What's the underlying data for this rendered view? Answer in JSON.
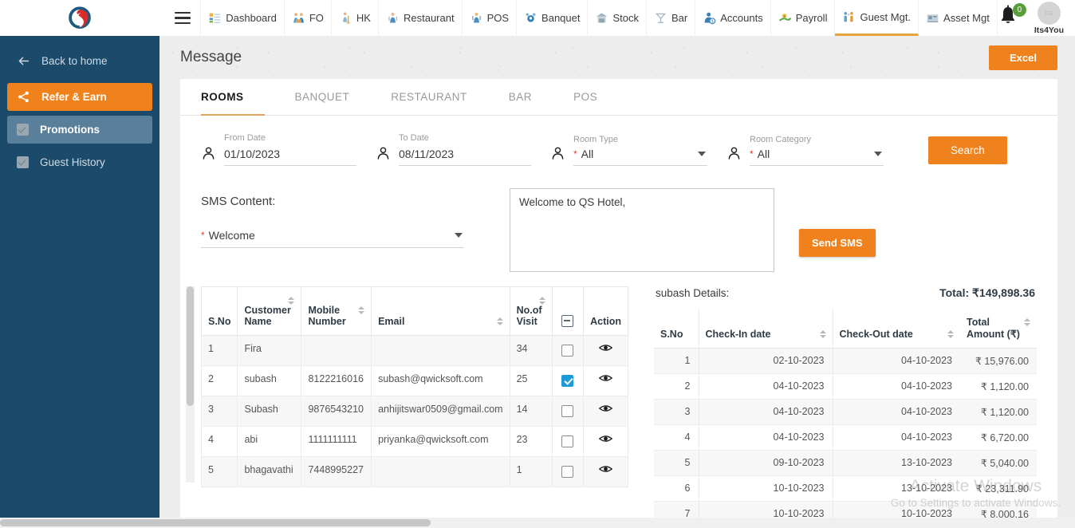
{
  "topnav": {
    "logo_name": "qs-logo",
    "menu_toggle": "menu-toggle",
    "items": [
      {
        "label": "Dashboard",
        "icon": "dashboard-icon",
        "active": false
      },
      {
        "label": "FO",
        "icon": "front-office-icon",
        "active": false
      },
      {
        "label": "HK",
        "icon": "housekeeping-icon",
        "active": false
      },
      {
        "label": "Restaurant",
        "icon": "restaurant-icon",
        "active": false
      },
      {
        "label": "POS",
        "icon": "pos-icon",
        "active": false
      },
      {
        "label": "Banquet",
        "icon": "banquet-icon",
        "active": false
      },
      {
        "label": "Stock",
        "icon": "stock-icon",
        "active": false
      },
      {
        "label": "Bar",
        "icon": "bar-icon",
        "active": false
      },
      {
        "label": "Accounts",
        "icon": "accounts-icon",
        "active": false
      },
      {
        "label": "Payroll",
        "icon": "payroll-icon",
        "active": false
      },
      {
        "label": "Guest Mgt.",
        "icon": "guest-management-icon",
        "active": true
      },
      {
        "label": "Asset Mgt",
        "icon": "asset-management-icon",
        "active": false
      }
    ],
    "notification_count": "0",
    "user_initials": "Its",
    "user_name": "Its4You"
  },
  "sidebar": {
    "back_label": "Back to home",
    "items": [
      {
        "label": "Refer & Earn",
        "icon": "share-icon",
        "state": "active"
      },
      {
        "label": "Promotions",
        "icon": "checkbox-icon",
        "state": "selected"
      },
      {
        "label": "Guest History",
        "icon": "checkbox-icon",
        "state": "normal"
      }
    ]
  },
  "header": {
    "title": "Message",
    "excel_label": "Excel"
  },
  "tabs": [
    {
      "label": "ROOMS",
      "active": true
    },
    {
      "label": "BANQUET",
      "active": false
    },
    {
      "label": "RESTAURANT",
      "active": false
    },
    {
      "label": "BAR",
      "active": false
    },
    {
      "label": "POS",
      "active": false
    }
  ],
  "filters": {
    "from_date": {
      "label": "From Date",
      "value": "01/10/2023"
    },
    "to_date": {
      "label": "To Date",
      "value": "08/11/2023"
    },
    "room_type": {
      "label": "Room Type",
      "value": "All",
      "required": "*"
    },
    "room_category": {
      "label": "Room Category",
      "value": "All",
      "required": "*"
    },
    "search_label": "Search"
  },
  "sms": {
    "title": "SMS Content:",
    "template_value": "Welcome",
    "template_required": "*",
    "message_value": "Welcome to QS Hotel,",
    "send_label": "Send SMS"
  },
  "customer_table": {
    "columns": [
      "S.No",
      "Customer Name",
      "Mobile Number",
      "Email",
      "No.of Visit",
      "",
      "Action"
    ],
    "select_all_icon": "indeterminate-checkbox-icon",
    "rows": [
      {
        "sno": "1",
        "name": "Fira",
        "mobile": "",
        "email": "",
        "visits": "34",
        "checked": false
      },
      {
        "sno": "2",
        "name": "subash",
        "mobile": "8122216016",
        "email": "subash@qwicksoft.com",
        "visits": "25",
        "checked": true
      },
      {
        "sno": "3",
        "name": "Subash",
        "mobile": "9876543210",
        "email": "anhijitswar0509@gmail.com",
        "visits": "14",
        "checked": false
      },
      {
        "sno": "4",
        "name": "abi",
        "mobile": "1111111111",
        "email": "priyanka@qwicksoft.com",
        "visits": "23",
        "checked": false
      },
      {
        "sno": "5",
        "name": "bhagavathi",
        "mobile": "7448995227",
        "email": "",
        "visits": "1",
        "checked": false
      }
    ]
  },
  "details_panel": {
    "title": "subash Details:",
    "total_label": "Total: ₹149,898.36",
    "columns": [
      "S.No",
      "Check-In date",
      "Check-Out date",
      "Total Amount (₹)"
    ],
    "rows": [
      {
        "sno": "1",
        "checkin": "02-10-2023",
        "checkout": "04-10-2023",
        "amount": "₹ 15,976.00"
      },
      {
        "sno": "2",
        "checkin": "04-10-2023",
        "checkout": "04-10-2023",
        "amount": "₹ 1,120.00"
      },
      {
        "sno": "3",
        "checkin": "04-10-2023",
        "checkout": "04-10-2023",
        "amount": "₹ 1,120.00"
      },
      {
        "sno": "4",
        "checkin": "04-10-2023",
        "checkout": "04-10-2023",
        "amount": "₹ 6,720.00"
      },
      {
        "sno": "5",
        "checkin": "09-10-2023",
        "checkout": "13-10-2023",
        "amount": "₹ 5,040.00"
      },
      {
        "sno": "6",
        "checkin": "10-10-2023",
        "checkout": "13-10-2023",
        "amount": "₹ 23,311.90"
      },
      {
        "sno": "7",
        "checkin": "10-10-2023",
        "checkout": "10-10-2023",
        "amount": "₹ 8,000.16"
      }
    ]
  },
  "watermark": {
    "line1": "Activate Windows",
    "line2": "Go to Settings to activate Windows."
  },
  "colors": {
    "accent_orange": "#f0821e",
    "sidebar_blue": "#1b4a6b",
    "sidebar_selected": "#5a7f9a",
    "checkbox_blue": "#1e9bd7",
    "badge_green": "#5a9e3a",
    "tab_underline": "#e0a458"
  }
}
